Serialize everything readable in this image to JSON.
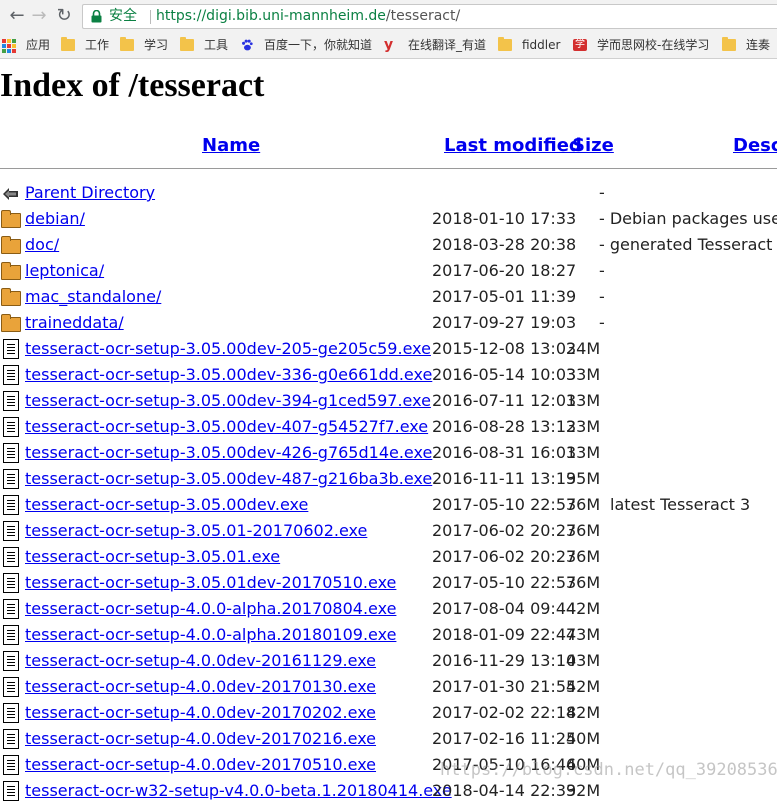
{
  "browser": {
    "secure_label": "安全",
    "url_host": "https://digi.bib.uni-mannheim.de",
    "url_path": "/tesseract/"
  },
  "bookmarks": [
    {
      "icon": "apps-icon",
      "label": "应用"
    },
    {
      "icon": "folder-icon",
      "label": "工作"
    },
    {
      "icon": "folder-icon",
      "label": "学习"
    },
    {
      "icon": "folder-icon",
      "label": "工具"
    },
    {
      "icon": "baidu-paw-icon",
      "label": "百度一下，你就知道"
    },
    {
      "icon": "youdao-icon",
      "label": "在线翻译_有道"
    },
    {
      "icon": "folder-icon",
      "label": "fiddler"
    },
    {
      "icon": "xueersi-icon",
      "label": "学而思网校-在线学习"
    },
    {
      "icon": "folder-icon",
      "label": "连奏"
    }
  ],
  "page": {
    "title": "Index of /tesseract",
    "columns": {
      "name": "Name",
      "last_modified": "Last modified",
      "size": "Size",
      "description": "Descr"
    }
  },
  "rows": [
    {
      "icon": "back-icon",
      "name": "Parent Directory",
      "modified": "",
      "size": "",
      "desc": "-"
    },
    {
      "icon": "folder-icon",
      "name": "debian/",
      "modified": "2018-01-10 17:33",
      "size": "",
      "desc": "- Debian packages used"
    },
    {
      "icon": "folder-icon",
      "name": "doc/",
      "modified": "2018-03-28 20:38",
      "size": "",
      "desc": "- generated Tesseract d"
    },
    {
      "icon": "folder-icon",
      "name": "leptonica/",
      "modified": "2017-06-20 18:27",
      "size": "",
      "desc": "-"
    },
    {
      "icon": "folder-icon",
      "name": "mac_standalone/",
      "modified": "2017-05-01 11:39",
      "size": "",
      "desc": "-"
    },
    {
      "icon": "folder-icon",
      "name": "traineddata/",
      "modified": "2017-09-27 19:03",
      "size": "",
      "desc": "-"
    },
    {
      "icon": "binary-file-icon",
      "name": "tesseract-ocr-setup-3.05.00dev-205-ge205c59.exe",
      "modified": "2015-12-08 13:03",
      "size": "24M",
      "desc": ""
    },
    {
      "icon": "binary-file-icon",
      "name": "tesseract-ocr-setup-3.05.00dev-336-g0e661dd.exe",
      "modified": "2016-05-14 10:03",
      "size": "33M",
      "desc": ""
    },
    {
      "icon": "binary-file-icon",
      "name": "tesseract-ocr-setup-3.05.00dev-394-g1ced597.exe",
      "modified": "2016-07-11 12:01",
      "size": "33M",
      "desc": ""
    },
    {
      "icon": "binary-file-icon",
      "name": "tesseract-ocr-setup-3.05.00dev-407-g54527f7.exe",
      "modified": "2016-08-28 13:12",
      "size": "33M",
      "desc": ""
    },
    {
      "icon": "binary-file-icon",
      "name": "tesseract-ocr-setup-3.05.00dev-426-g765d14e.exe",
      "modified": "2016-08-31 16:01",
      "size": "33M",
      "desc": ""
    },
    {
      "icon": "binary-file-icon",
      "name": "tesseract-ocr-setup-3.05.00dev-487-g216ba3b.exe",
      "modified": "2016-11-11 13:19",
      "size": "35M",
      "desc": ""
    },
    {
      "icon": "binary-file-icon",
      "name": "tesseract-ocr-setup-3.05.00dev.exe",
      "modified": "2017-05-10 22:57",
      "size": "36M",
      "desc": "latest Tesseract 3"
    },
    {
      "icon": "binary-file-icon",
      "name": "tesseract-ocr-setup-3.05.01-20170602.exe",
      "modified": "2017-06-02 20:27",
      "size": "36M",
      "desc": ""
    },
    {
      "icon": "binary-file-icon",
      "name": "tesseract-ocr-setup-3.05.01.exe",
      "modified": "2017-06-02 20:27",
      "size": "36M",
      "desc": ""
    },
    {
      "icon": "binary-file-icon",
      "name": "tesseract-ocr-setup-3.05.01dev-20170510.exe",
      "modified": "2017-05-10 22:57",
      "size": "36M",
      "desc": ""
    },
    {
      "icon": "binary-file-icon",
      "name": "tesseract-ocr-setup-4.0.0-alpha.20170804.exe",
      "modified": "2017-08-04 09:44",
      "size": "42M",
      "desc": ""
    },
    {
      "icon": "binary-file-icon",
      "name": "tesseract-ocr-setup-4.0.0-alpha.20180109.exe",
      "modified": "2018-01-09 22:47",
      "size": "43M",
      "desc": ""
    },
    {
      "icon": "binary-file-icon",
      "name": "tesseract-ocr-setup-4.0.0dev-20161129.exe",
      "modified": "2016-11-29 13:10",
      "size": "43M",
      "desc": ""
    },
    {
      "icon": "binary-file-icon",
      "name": "tesseract-ocr-setup-4.0.0dev-20170130.exe",
      "modified": "2017-01-30 21:55",
      "size": "42M",
      "desc": ""
    },
    {
      "icon": "binary-file-icon",
      "name": "tesseract-ocr-setup-4.0.0dev-20170202.exe",
      "modified": "2017-02-02 22:18",
      "size": "42M",
      "desc": ""
    },
    {
      "icon": "binary-file-icon",
      "name": "tesseract-ocr-setup-4.0.0dev-20170216.exe",
      "modified": "2017-02-16 11:25",
      "size": "40M",
      "desc": ""
    },
    {
      "icon": "binary-file-icon",
      "name": "tesseract-ocr-setup-4.0.0dev-20170510.exe",
      "modified": "2017-05-10 16:46",
      "size": "40M",
      "desc": ""
    },
    {
      "icon": "binary-file-icon",
      "name": "tesseract-ocr-w32-setup-v4.0.0-beta.1.20180414.exe",
      "modified": "2018-04-14 22:39",
      "size": "32M",
      "desc": ""
    }
  ],
  "watermark": "https://blog.csdn.net/qq_39208536",
  "colors": {
    "link": "#0000ee",
    "secure": "#0b8043",
    "folder": "#e9a33a",
    "bookmark_folder": "#f3c34a"
  }
}
